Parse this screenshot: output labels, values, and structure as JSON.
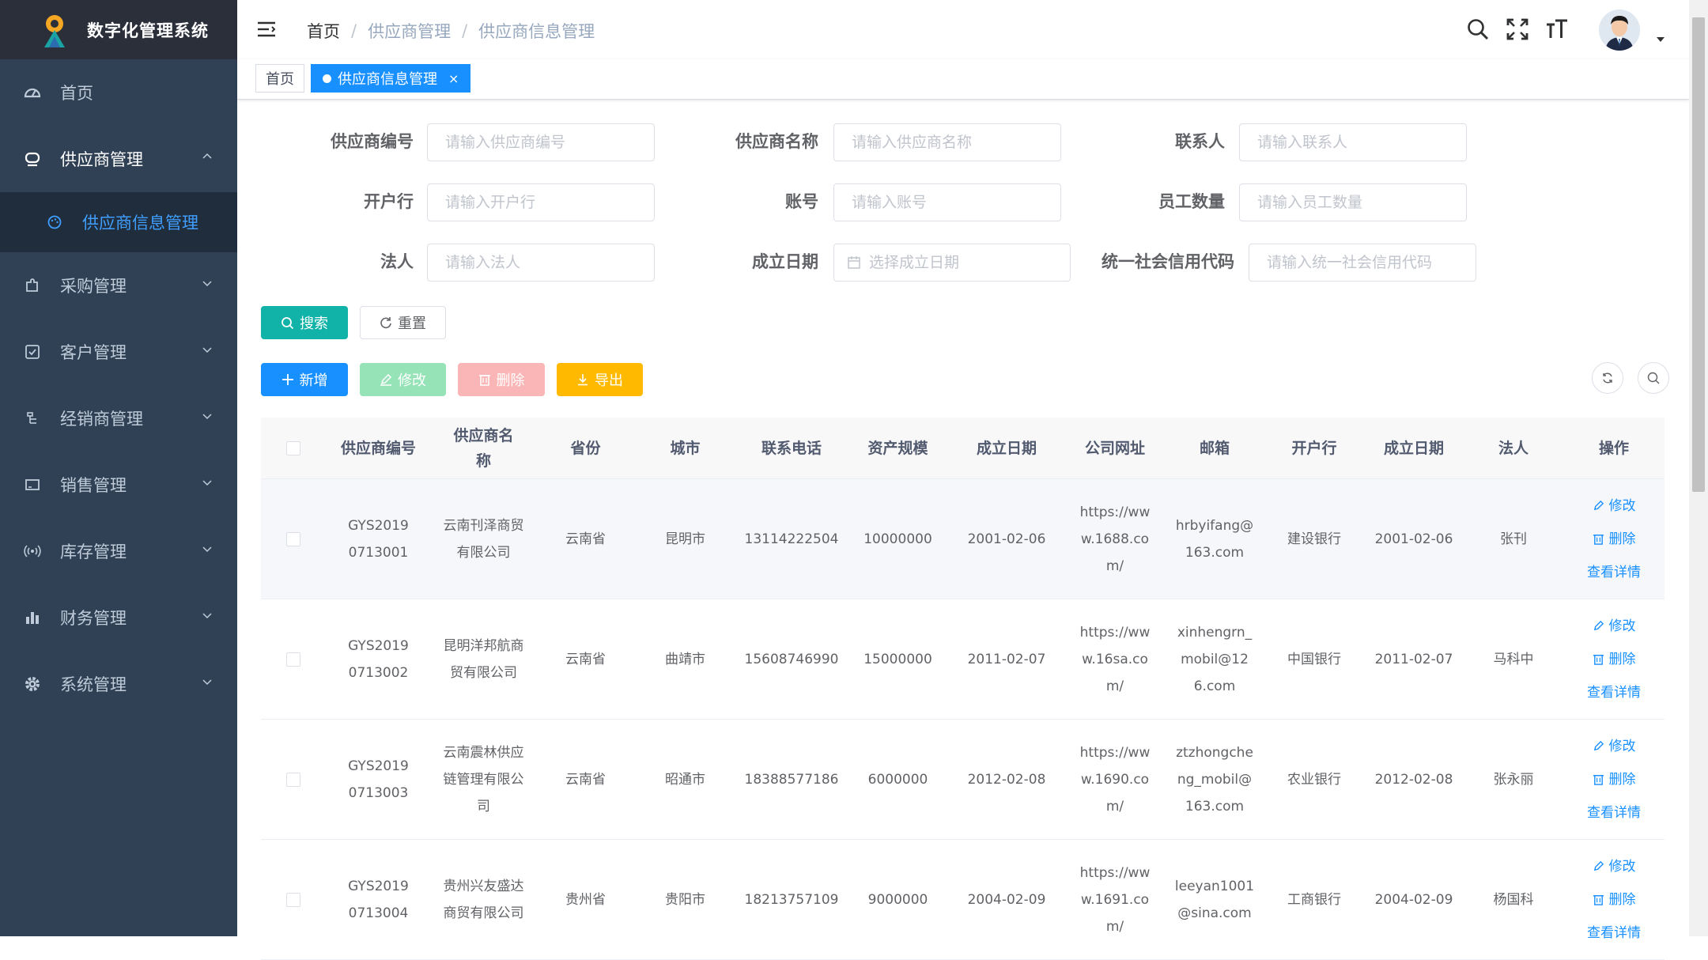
{
  "app": {
    "title": "数字化管理系统"
  },
  "sidebar": {
    "items": [
      {
        "label": "首页",
        "icon": "dashboard-icon"
      },
      {
        "label": "供应商管理",
        "icon": "supplier-icon",
        "open": true,
        "children": [
          {
            "label": "供应商信息管理",
            "icon": "palette-icon",
            "active": true
          }
        ]
      },
      {
        "label": "采购管理",
        "icon": "puzzle-icon"
      },
      {
        "label": "客户管理",
        "icon": "checkbox-icon"
      },
      {
        "label": "经销商管理",
        "icon": "list-icon"
      },
      {
        "label": "销售管理",
        "icon": "monitor-icon"
      },
      {
        "label": "库存管理",
        "icon": "broadcast-icon"
      },
      {
        "label": "财务管理",
        "icon": "chart-icon"
      },
      {
        "label": "系统管理",
        "icon": "gear-icon"
      }
    ]
  },
  "header": {
    "breadcrumb": [
      "首页",
      "供应商管理",
      "供应商信息管理"
    ],
    "separator": "/"
  },
  "tags": {
    "home": "首页",
    "active": "供应商信息管理",
    "close": "×"
  },
  "form": {
    "supplier_code": {
      "label": "供应商编号",
      "placeholder": "请输入供应商编号"
    },
    "supplier_name": {
      "label": "供应商名称",
      "placeholder": "请输入供应商名称"
    },
    "contact": {
      "label": "联系人",
      "placeholder": "请输入联系人"
    },
    "bank": {
      "label": "开户行",
      "placeholder": "请输入开户行"
    },
    "account": {
      "label": "账号",
      "placeholder": "请输入账号"
    },
    "employees": {
      "label": "员工数量",
      "placeholder": "请输入员工数量"
    },
    "legal": {
      "label": "法人",
      "placeholder": "请输入法人"
    },
    "founded": {
      "label": "成立日期",
      "placeholder": "选择成立日期"
    },
    "credit_code": {
      "label": "统一社会信用代码",
      "placeholder": "请输入统一社会信用代码"
    }
  },
  "buttons": {
    "search": "搜索",
    "reset": "重置",
    "add": "新增",
    "edit": "修改",
    "delete": "删除",
    "export": "导出"
  },
  "table": {
    "columns": [
      "供应商编号",
      "供应商名称",
      "省份",
      "城市",
      "联系电话",
      "资产规模",
      "成立日期",
      "公司网址",
      "邮箱",
      "开户行",
      "成立日期",
      "法人",
      "操作"
    ],
    "ops": {
      "edit": "修改",
      "delete": "删除",
      "detail": "查看详情"
    },
    "rows": [
      {
        "code": "GYS20190713001",
        "name": "云南刊泽商贸有限公司",
        "province": "云南省",
        "city": "昆明市",
        "phone": "13114222504",
        "assets": "10000000",
        "date": "2001-02-06",
        "url": "https://www.1688.com/",
        "email": "hrbyifang@163.com",
        "bank": "建设银行",
        "date2": "2001-02-06",
        "legal": "张刊"
      },
      {
        "code": "GYS20190713002",
        "name": "昆明洋邦航商贸有限公司",
        "province": "云南省",
        "city": "曲靖市",
        "phone": "15608746990",
        "assets": "15000000",
        "date": "2011-02-07",
        "url": "https://www.16sa.com/",
        "email": "xinhengrn_mobil@126.com",
        "bank": "中国银行",
        "date2": "2011-02-07",
        "legal": "马科中"
      },
      {
        "code": "GYS20190713003",
        "name": "云南震林供应链管理有限公司",
        "province": "云南省",
        "city": "昭通市",
        "phone": "18388577186",
        "assets": "6000000",
        "date": "2012-02-08",
        "url": "https://www.1690.com/",
        "email": "ztzhongcheng_mobil@163.com",
        "bank": "农业银行",
        "date2": "2012-02-08",
        "legal": "张永丽"
      },
      {
        "code": "GYS20190713004",
        "name": "贵州兴友盛达商贸有限公司",
        "province": "贵州省",
        "city": "贵阳市",
        "phone": "18213757109",
        "assets": "9000000",
        "date": "2004-02-09",
        "url": "https://www.1691.com/",
        "email": "leeyan1001@sina.com",
        "bank": "工商银行",
        "date2": "2004-02-09",
        "legal": "杨国科"
      }
    ]
  },
  "colors": {
    "sidebar": "#304156",
    "primary": "#1890ff",
    "search": "#11b3a8",
    "edit": "#95e3b7",
    "delete": "#fab6b6",
    "export": "#ffba00"
  }
}
